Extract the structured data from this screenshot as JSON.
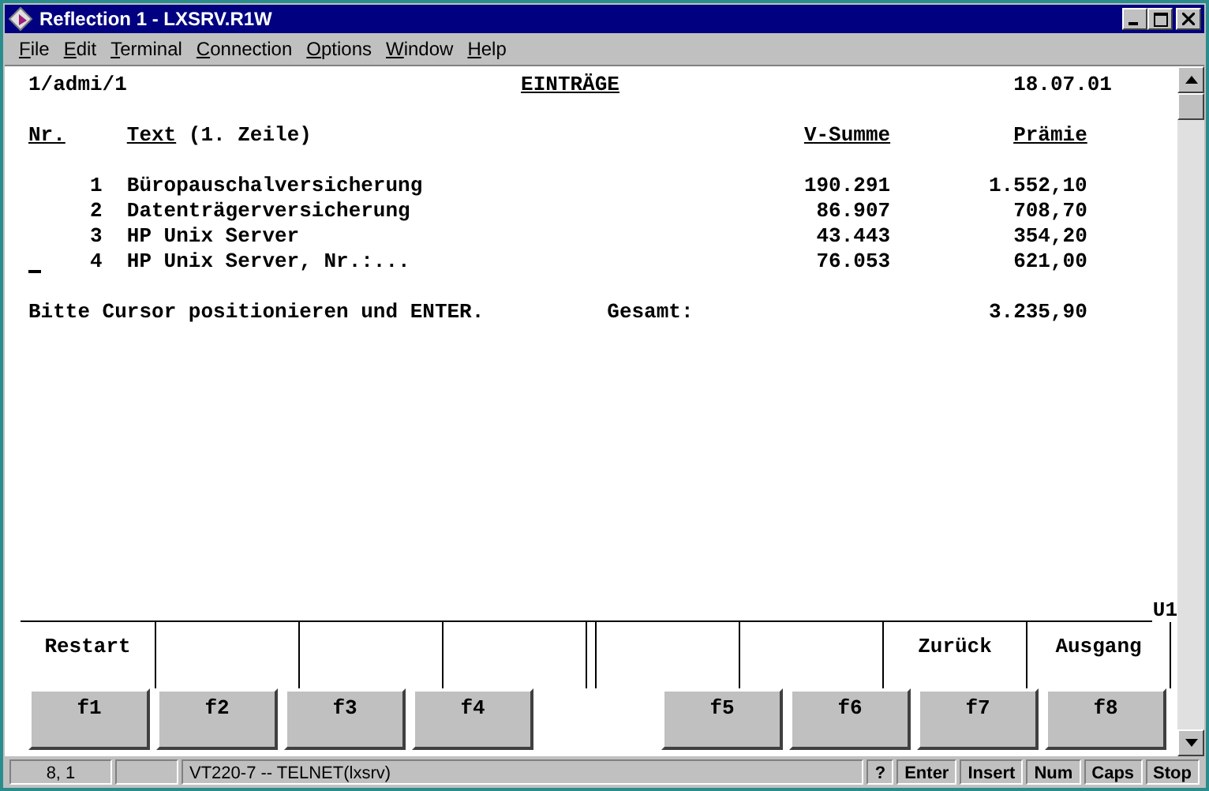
{
  "window": {
    "title": "Reflection 1 - LXSRV.R1W"
  },
  "menu": [
    {
      "label": "File"
    },
    {
      "label": "Edit"
    },
    {
      "label": "Terminal"
    },
    {
      "label": "Connection"
    },
    {
      "label": "Options"
    },
    {
      "label": "Window"
    },
    {
      "label": "Help"
    }
  ],
  "screen": {
    "path": "1/admi/1",
    "title": "EINTRÄGE",
    "date": "18.07.01",
    "columns": [
      {
        "label": "Nr."
      },
      {
        "label": "Text",
        "note": "(1. Zeile)"
      },
      {
        "label": "V-Summe"
      },
      {
        "label": "Prämie"
      }
    ],
    "rows": [
      {
        "nr": "1",
        "text": "Büropauschalversicherung",
        "sum": "190.291",
        "premium": "1.552,10",
        "cursor": false
      },
      {
        "nr": "2",
        "text": "Datenträgerversicherung",
        "sum": "86.907",
        "premium": "708,70",
        "cursor": false
      },
      {
        "nr": "3",
        "text": "HP Unix Server",
        "sum": "43.443",
        "premium": "354,20",
        "cursor": false
      },
      {
        "nr": "4",
        "text": "HP Unix Server, Nr.:...",
        "sum": "76.053",
        "premium": "621,00",
        "cursor": true
      }
    ],
    "message": "Bitte Cursor positionieren und ENTER.",
    "total_label": "Gesamt:",
    "total": "3.235,90"
  },
  "softkeys": {
    "indicator": "U1",
    "keys": [
      {
        "key": "f1",
        "label": "Restart"
      },
      {
        "key": "f2"
      },
      {
        "key": "f3"
      },
      {
        "key": "f4"
      },
      {
        "key": "f5"
      },
      {
        "key": "f6"
      },
      {
        "key": "f7",
        "label": "Zurück"
      },
      {
        "key": "f8",
        "label": "Ausgang"
      }
    ]
  },
  "status_bar": {
    "position": "8, 1",
    "connection": "VT220-7 -- TELNET(lxsrv)",
    "keys": [
      "?",
      "Enter",
      "Insert",
      "Num",
      "Caps",
      "Stop"
    ]
  }
}
